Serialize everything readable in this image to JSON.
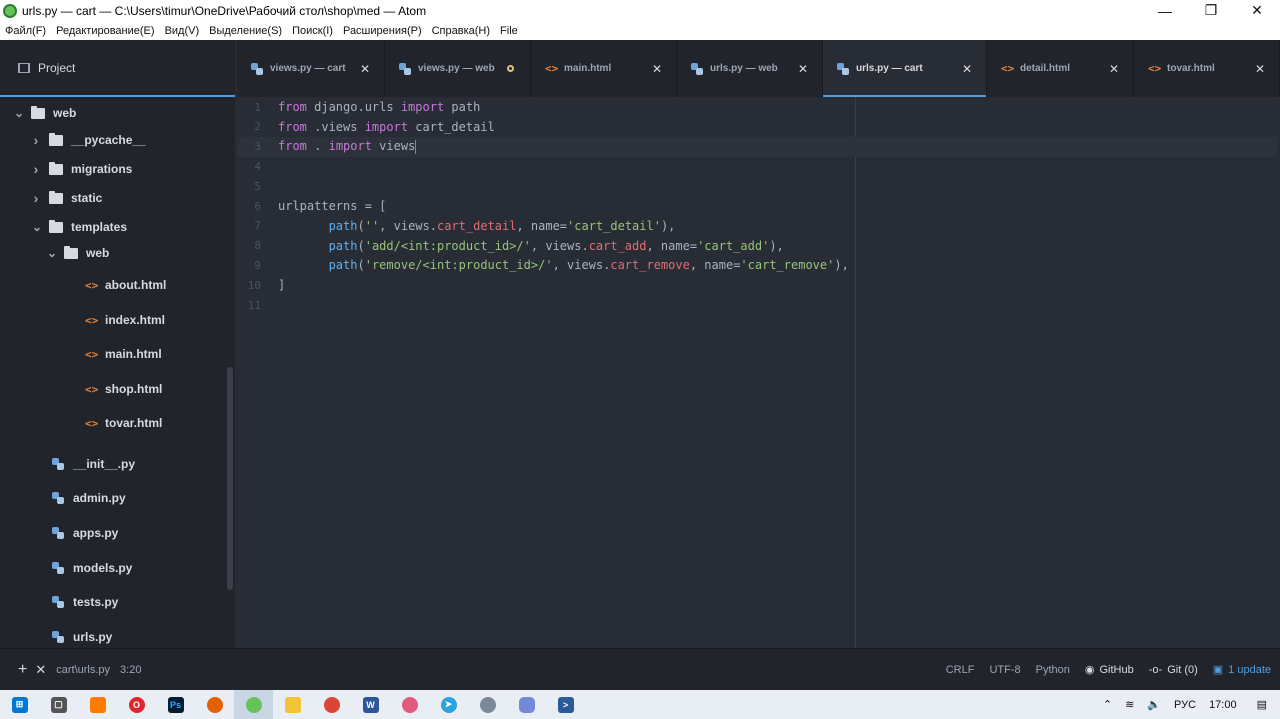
{
  "window": {
    "title": "urls.py — cart — C:\\Users\\timur\\OneDrive\\Рабочий стол\\shop\\med — Atom",
    "controls": [
      "minimize-icon",
      "restore-icon",
      "close-icon"
    ]
  },
  "menu": [
    "Файл(F)",
    "Редактирование(E)",
    "Вид(V)",
    "Выделение(S)",
    "Поиск(I)",
    "Расширения(P)",
    "Справка(H)",
    "File"
  ],
  "sidebar": {
    "title": "Project",
    "tree": [
      {
        "label": "web",
        "type": "folder",
        "expanded": true
      },
      {
        "label": "__pycache__",
        "type": "folder",
        "expanded": false
      },
      {
        "label": "migrations",
        "type": "folder",
        "expanded": false
      },
      {
        "label": "static",
        "type": "folder",
        "expanded": false
      },
      {
        "label": "templates",
        "type": "folder",
        "expanded": true
      },
      {
        "label": "web",
        "type": "folder",
        "expanded": true
      },
      {
        "label": "about.html",
        "type": "html"
      },
      {
        "label": "index.html",
        "type": "html"
      },
      {
        "label": "main.html",
        "type": "html"
      },
      {
        "label": "shop.html",
        "type": "html"
      },
      {
        "label": "tovar.html",
        "type": "html"
      },
      {
        "label": "__init__.py",
        "type": "py"
      },
      {
        "label": "admin.py",
        "type": "py"
      },
      {
        "label": "apps.py",
        "type": "py"
      },
      {
        "label": "models.py",
        "type": "py"
      },
      {
        "label": "tests.py",
        "type": "py"
      },
      {
        "label": "urls.py",
        "type": "py"
      }
    ]
  },
  "tabs": [
    {
      "label": "views.py — cart",
      "icon": "python-icon",
      "modified": false,
      "active": false
    },
    {
      "label": "views.py — web",
      "icon": "python-icon",
      "modified": true,
      "active": false
    },
    {
      "label": "main.html",
      "icon": "html-icon",
      "modified": false,
      "active": false
    },
    {
      "label": "urls.py — web",
      "icon": "python-icon",
      "modified": false,
      "active": false
    },
    {
      "label": "urls.py — cart",
      "icon": "python-icon",
      "modified": false,
      "active": true
    },
    {
      "label": "detail.html",
      "icon": "html-icon",
      "modified": false,
      "active": false
    },
    {
      "label": "tovar.html",
      "icon": "html-icon",
      "modified": false,
      "active": false
    }
  ],
  "editor": {
    "cursor_line": 3,
    "lines": [
      {
        "n": "1",
        "tokens": [
          [
            "kw",
            "from"
          ],
          [
            "plain",
            " django.urls "
          ],
          [
            "kw",
            "import"
          ],
          [
            "plain",
            " path"
          ]
        ]
      },
      {
        "n": "2",
        "tokens": [
          [
            "kw",
            "from"
          ],
          [
            "plain",
            " .views "
          ],
          [
            "kw",
            "import"
          ],
          [
            "plain",
            " cart_detail"
          ]
        ]
      },
      {
        "n": "3",
        "tokens": [
          [
            "kw",
            "from"
          ],
          [
            "plain",
            " . "
          ],
          [
            "kw",
            "import"
          ],
          [
            "plain",
            " views"
          ]
        ]
      },
      {
        "n": "4",
        "tokens": []
      },
      {
        "n": "5",
        "tokens": []
      },
      {
        "n": "6",
        "tokens": [
          [
            "plain",
            "urlpatterns = ["
          ]
        ]
      },
      {
        "n": "7",
        "tokens": [
          [
            "plain",
            "       "
          ],
          [
            "fn",
            "path"
          ],
          [
            "plain",
            "("
          ],
          [
            "str",
            "''"
          ],
          [
            "plain",
            ", views."
          ],
          [
            "attr",
            "cart_detail"
          ],
          [
            "plain",
            ", name="
          ],
          [
            "str",
            "'cart_detail'"
          ],
          [
            "plain",
            "),"
          ]
        ]
      },
      {
        "n": "8",
        "tokens": [
          [
            "plain",
            "       "
          ],
          [
            "fn",
            "path"
          ],
          [
            "plain",
            "("
          ],
          [
            "str",
            "'add/<int:product_id>/'"
          ],
          [
            "plain",
            ", views."
          ],
          [
            "attr",
            "cart_add"
          ],
          [
            "plain",
            ", name="
          ],
          [
            "str",
            "'cart_add'"
          ],
          [
            "plain",
            "),"
          ]
        ]
      },
      {
        "n": "9",
        "tokens": [
          [
            "plain",
            "       "
          ],
          [
            "fn",
            "path"
          ],
          [
            "plain",
            "("
          ],
          [
            "str",
            "'remove/<int:product_id>/'"
          ],
          [
            "plain",
            ", views."
          ],
          [
            "attr",
            "cart_remove"
          ],
          [
            "plain",
            ", name="
          ],
          [
            "str",
            "'cart_remove'"
          ],
          [
            "plain",
            "),"
          ]
        ]
      },
      {
        "n": "10",
        "tokens": [
          [
            "plain",
            "]"
          ]
        ]
      },
      {
        "n": "11",
        "tokens": []
      }
    ]
  },
  "status": {
    "file_path": "cart\\urls.py",
    "cursor": "3:20",
    "line_ending": "CRLF",
    "encoding": "UTF-8",
    "grammar": "Python",
    "github": "GitHub",
    "git": "Git (0)",
    "updates": "1 update"
  },
  "taskbar": {
    "apps": [
      "start-icon",
      "task-view-icon",
      "explorer-app-icon",
      "opera-icon",
      "photoshop-icon",
      "firefox-icon",
      "atom-icon",
      "file-explorer-icon",
      "chrome-icon",
      "word-icon",
      "paint-icon",
      "telegram-icon",
      "steam-icon",
      "discord-icon",
      "powershell-icon"
    ],
    "language": "РУС",
    "time": "17:00"
  }
}
